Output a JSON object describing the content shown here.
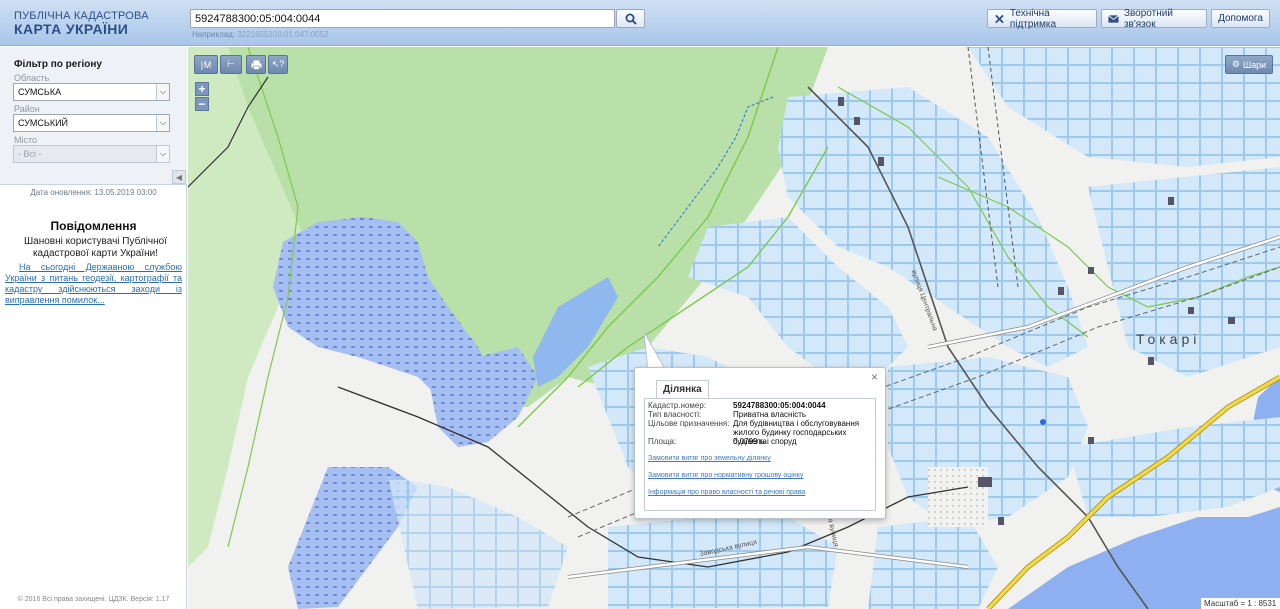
{
  "header": {
    "logo_line1": "ПУБЛІЧНА КАДАСТРОВА",
    "logo_line2": "КАРТА УКРАЇНИ",
    "search_value": "5924788300:05:004:0044",
    "search_hint_label": "Наприклад:",
    "search_hint_example": "3221655100:01:047:0052",
    "support_label": "Технічна підтримка",
    "feedback_label": "Зворотний зв'язок",
    "help_label": "Допомога"
  },
  "sidebar": {
    "filter_title": "Фільтр по регіону",
    "region_label": "Область",
    "region_value": "СУМСЬКА",
    "district_label": "Район",
    "district_value": "СУМСЬКИЙ",
    "city_label": "Місто",
    "city_value": "- Всі -",
    "update_date": "Дата оновлення: 13.05.2019 03:00",
    "notice_title": "Повідомлення",
    "notice_text": "Шановні користувачі Публічної кадастрової карти України!",
    "notice_link": "На сьогодні Державною службою України з питань геодезії, картографії та кадастру здійснюються заходи із виправлення помилок...",
    "footer": "© 2016 Всі права захищені. ЦДЗК. Версія: 1.17"
  },
  "map": {
    "layers_label": "Шари",
    "place_label": "Токарі",
    "scale_text": "Масштаб = 1 : 8531",
    "street_a": "Заводська вулиця",
    "street_b": "Садова вулиця",
    "street_c": "вулиця Центральна",
    "tools": [
      "ruler-length-icon",
      "ruler-area-icon",
      "print-icon",
      "info-cursor-icon"
    ]
  },
  "popup": {
    "tab_label": "Ділянка",
    "rows": [
      {
        "label": "Кадастр.номер:",
        "value": "5924788300:05:004:0044"
      },
      {
        "label": "Тип власності:",
        "value": "Приватна власність"
      },
      {
        "label": "Цільове призначення:",
        "value": "Для будівництва і обслуговування жилого будинку господарських будівель і споруд"
      },
      {
        "label": "Площа:",
        "value": "0.0799 га"
      }
    ],
    "link1": "Замовити витяг про земельну ділянку",
    "link2": "Замовити витяг про нормативну грошову оцінку",
    "link3": "Інформація про право власності та речові права"
  },
  "colors": {
    "header_bg": "#b8d0ee",
    "map_green": "#b6dfa6",
    "water": "#8fb0f0",
    "parcel": "#c9e2f6",
    "boundary": "#7fc84c"
  }
}
